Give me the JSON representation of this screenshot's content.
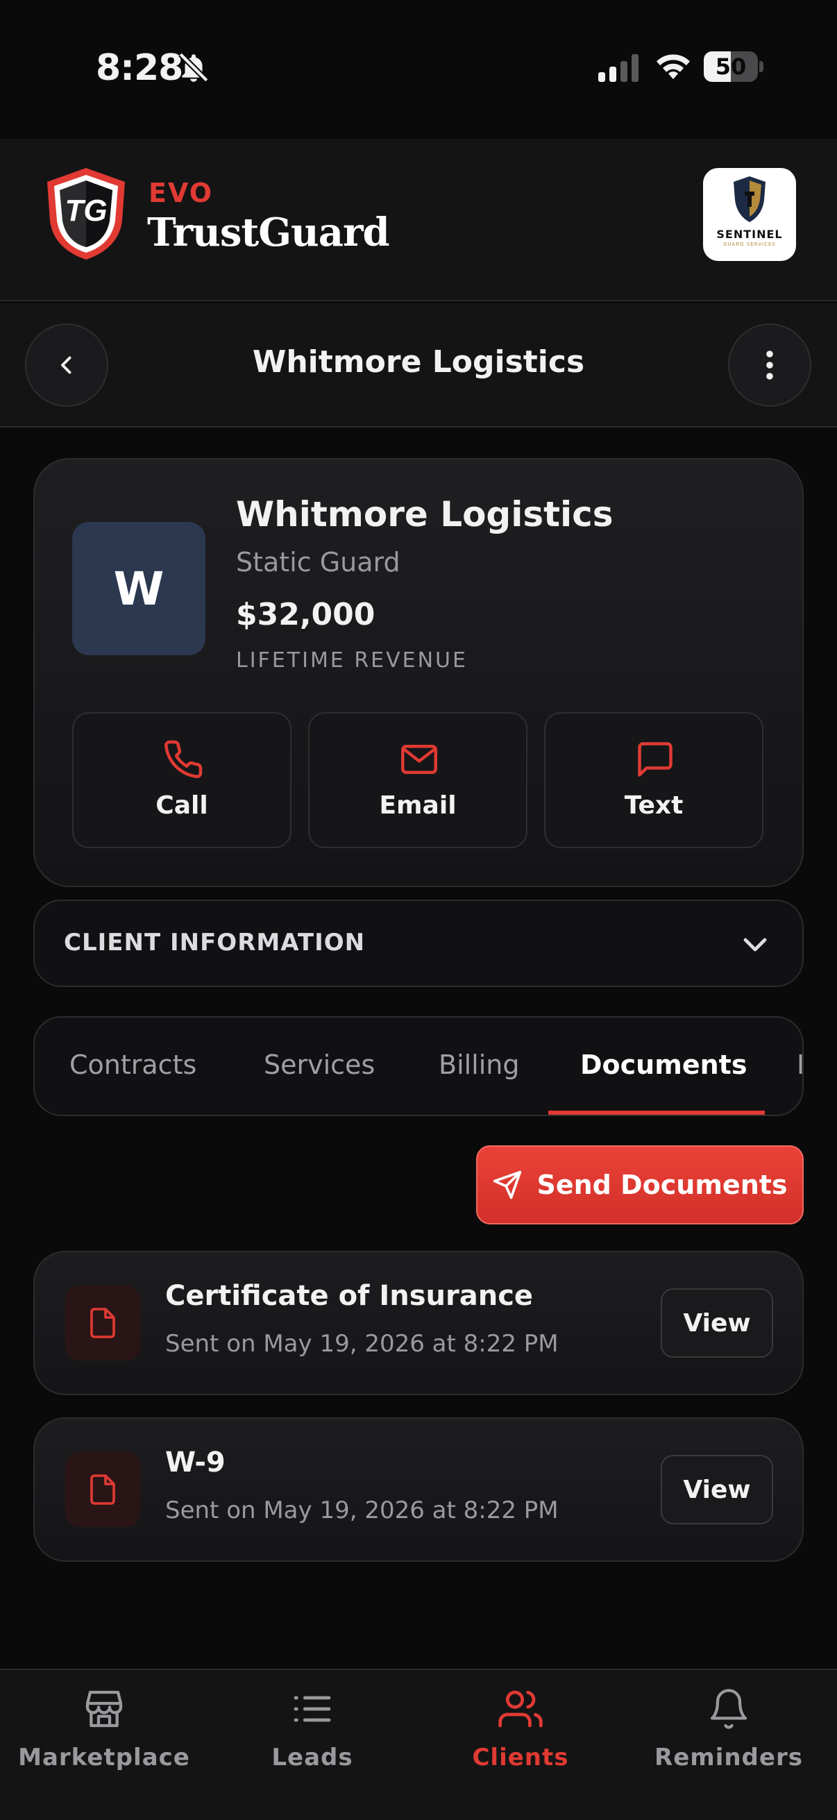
{
  "status_bar": {
    "time": "8:28",
    "battery": "50",
    "battery_level": 0.5
  },
  "brand": {
    "evo": "EVO",
    "name": "TrustGuard",
    "logo_letters": "TG",
    "partner_name": "SENTINEL",
    "partner_sub": "GUARD SERVICES"
  },
  "nav": {
    "title": "Whitmore Logistics"
  },
  "client": {
    "initial": "W",
    "name": "Whitmore Logistics",
    "service": "Static Guard",
    "revenue": "$32,000",
    "revenue_label": "LIFETIME REVENUE",
    "actions": {
      "call": "Call",
      "email": "Email",
      "text": "Text"
    }
  },
  "client_info": {
    "label": "CLIENT INFORMATION"
  },
  "tabs": [
    {
      "label": "Contracts"
    },
    {
      "label": "Services"
    },
    {
      "label": "Billing"
    },
    {
      "label": "Documents"
    },
    {
      "label": "I"
    }
  ],
  "send_documents": {
    "label": "Send Documents"
  },
  "documents": [
    {
      "title": "Certificate of Insurance",
      "sent": "Sent on May 19, 2026 at 8:22 PM",
      "view_label": "View"
    },
    {
      "title": "W-9",
      "sent": "Sent on May 19, 2026 at 8:22 PM",
      "view_label": "View"
    }
  ],
  "bottom_nav": [
    {
      "label": "Marketplace",
      "icon": "store-icon"
    },
    {
      "label": "Leads",
      "icon": "list-icon"
    },
    {
      "label": "Clients",
      "icon": "users-icon",
      "active": true
    },
    {
      "label": "Reminders",
      "icon": "bell-icon"
    }
  ],
  "colors": {
    "accent": "#e03a33",
    "background": "#0a0a0b",
    "surface": "#141415",
    "avatar": "#2c3850"
  }
}
